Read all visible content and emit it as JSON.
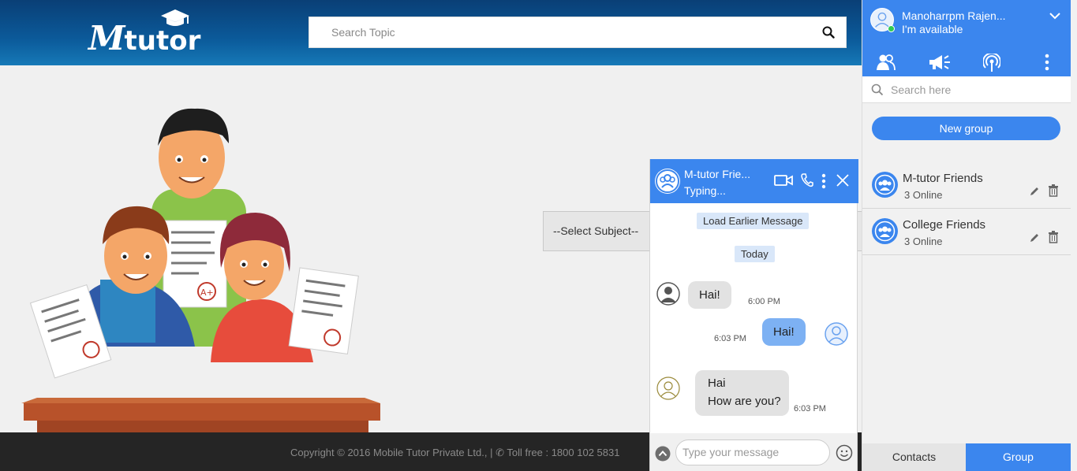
{
  "header": {
    "logo_text": "Mtutor",
    "search_placeholder": "Search Topic"
  },
  "main": {
    "select_subject": "--Select Subject--"
  },
  "footer": {
    "copyright": "Copyright © 2016 Mobile Tutor Private Ltd., | ✆ Toll free : 1800 102 5831"
  },
  "chat": {
    "title": "M-tutor Frie...",
    "status": "Typing...",
    "load_earlier": "Load Earlier Message",
    "day_label": "Today",
    "messages": [
      {
        "text": "Hai!",
        "time": "6:00 PM"
      },
      {
        "text": "Hai!",
        "time": "6:03 PM"
      },
      {
        "line1": "Hai",
        "line2": "How are you?",
        "time": "6:03 PM"
      }
    ],
    "input_placeholder": "Type your message"
  },
  "panel": {
    "user_name": "Manoharrpm Rajen...",
    "user_status": "I'm available",
    "search_placeholder": "Search here",
    "new_group_label": "New group",
    "groups": [
      {
        "name": "M-tutor Friends",
        "online": "3 Online"
      },
      {
        "name": "College Friends",
        "online": "3 Online"
      }
    ],
    "tabs": {
      "contacts": "Contacts",
      "group": "Group"
    }
  },
  "colors": {
    "accent": "#3b86ee",
    "header_dark": "#0a3f76",
    "footer_bg": "#252525",
    "online": "#2ecc52"
  }
}
